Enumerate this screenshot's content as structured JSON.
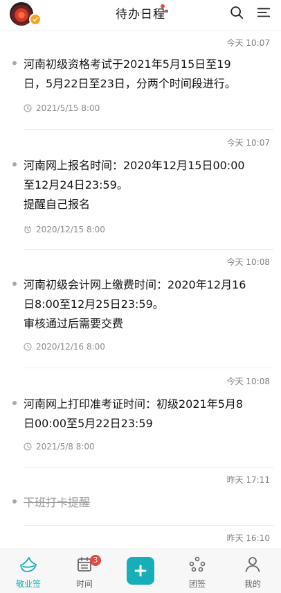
{
  "header": {
    "title": "待办日程"
  },
  "entries": [
    {
      "time": "今天 10:07",
      "text": "河南初级资格考试于2021年5月15日至19\n日，5月22日至23日，分两个时间段进行。",
      "date": "2021/5/15 8:00",
      "icon": "clock-icon"
    },
    {
      "time": "今天 10:07",
      "text": "河南网上报名时间：2020年12月15日00:00\n至12月24日23:59。\n提醒自己报名",
      "date": "2020/12/15 8:00",
      "icon": "alarm-icon"
    },
    {
      "time": "今天 10:08",
      "text": "河南初级会计网上缴费时间：2020年12月16\n日8:00至12月25日23:59。\n审核通过后需要交费",
      "date": "2020/12/16 8:00",
      "icon": "clock-icon"
    },
    {
      "time": "今天 10:08",
      "text": "河南网上打印准考证时间：初级2021年5月8\n日00:00至5月22日23:59",
      "date": "2021/5/8 8:00",
      "icon": "clock-icon"
    },
    {
      "time": "昨天  17:11",
      "text": "下班打卡提醒",
      "date": "",
      "icon": ""
    },
    {
      "time": "昨天  16:10",
      "text": "",
      "date": "",
      "icon": ""
    }
  ],
  "tabs": [
    {
      "label": "敬业签",
      "icon": "sign-icon",
      "active": true
    },
    {
      "label": "时间",
      "icon": "calendar-icon",
      "badge": "3"
    },
    {
      "label": "",
      "icon": "plus-icon"
    },
    {
      "label": "团签",
      "icon": "team-icon"
    },
    {
      "label": "我的",
      "icon": "user-icon"
    }
  ],
  "colors": {
    "accent": "#18aeb9",
    "badge": "#e64545",
    "avatar_badge": "#f5a623"
  }
}
